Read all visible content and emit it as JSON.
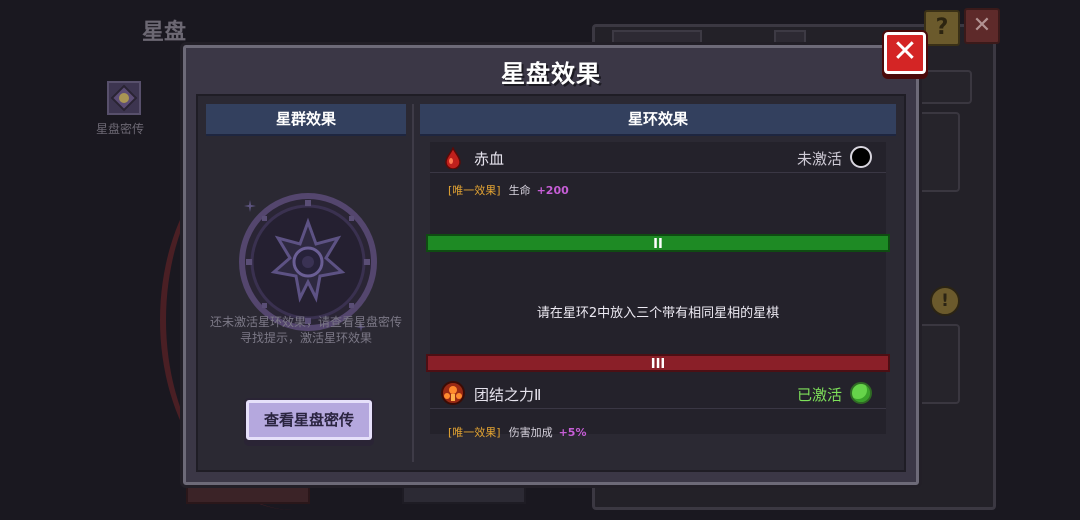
{
  "background": {
    "title": "星盘",
    "star_label": "星盘密传"
  },
  "modal": {
    "title": "星盘效果",
    "close_label": "✕"
  },
  "left": {
    "header": "星群效果",
    "hint": "还未激活星环效果，请查看星盘密传寻找提示，激活星环效果",
    "button_label": "查看星盘密传"
  },
  "right": {
    "header": "星环效果",
    "tier1": {
      "name": "赤血",
      "icon": "blood-drop-icon",
      "status": "未激活",
      "status_color": "#cfcbd6",
      "tag": "[唯一效果]",
      "stat": "生命",
      "bonus": "+200"
    },
    "tier2": {
      "label": "II",
      "color": "#1e8a24",
      "requirement": "请在星环2中放入三个带有相同星相的星棋"
    },
    "tier3": {
      "label": "III",
      "color": "#8a1f28",
      "name": "团结之力Ⅱ",
      "icon": "unity-emblem-icon",
      "status": "已激活",
      "status_color": "#7ee05a",
      "tag": "[唯一效果]",
      "stat": "伤害加成",
      "bonus": "+5%"
    }
  }
}
